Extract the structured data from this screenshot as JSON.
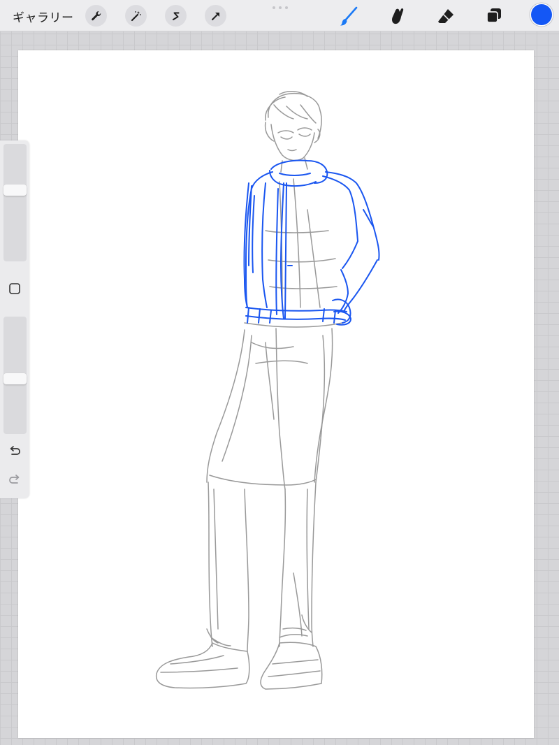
{
  "topbar": {
    "gallery_label": "ギャラリー",
    "left_tools": [
      {
        "icon": "wrench-icon"
      },
      {
        "icon": "magic-wand-icon"
      },
      {
        "icon": "selection-s-icon"
      },
      {
        "icon": "arrow-transform-icon"
      }
    ],
    "right_tools": [
      {
        "icon": "brush-icon",
        "active": true
      },
      {
        "icon": "smudge-icon"
      },
      {
        "icon": "eraser-icon"
      },
      {
        "icon": "layers-icon"
      }
    ],
    "current_color": "#1457f5"
  },
  "sidebar": {
    "brush_size_level": 0.62,
    "opacity_level": 0.47,
    "buttons": [
      "modify-square-icon",
      "undo-icon",
      "redo-icon"
    ]
  },
  "canvas": {
    "sketch_colors": {
      "pencil": "#8e8e8e",
      "ink": "#1a56f0"
    }
  }
}
